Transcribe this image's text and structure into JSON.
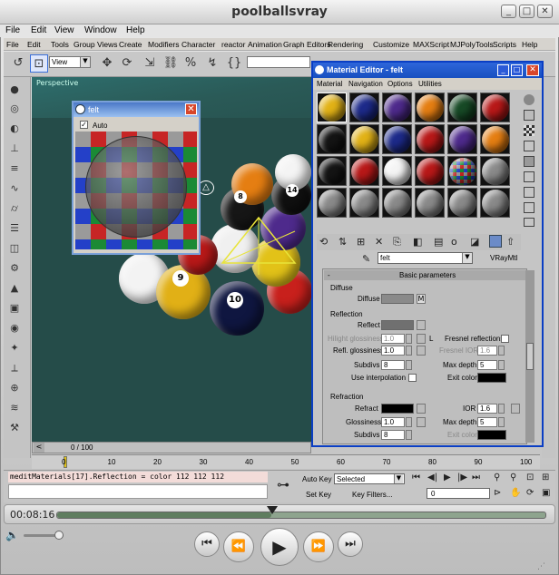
{
  "window": {
    "title": "poolballsvray",
    "minimize": "_",
    "maximize": "□",
    "close": "✕"
  },
  "menu": [
    "File",
    "Edit",
    "View",
    "Window",
    "Help"
  ],
  "max_menu": [
    "File",
    "Edit",
    "Tools",
    "Group",
    "Views",
    "Create",
    "Modifiers",
    "Character",
    "reactor",
    "Animation",
    "Graph Editors",
    "Rendering",
    "Customize",
    "MAXScript",
    "MJPolyTools",
    "Scripts",
    "Help"
  ],
  "toolbar": {
    "view_select": "View"
  },
  "viewport": {
    "label": "Perspective"
  },
  "felt_window": {
    "title": "felt",
    "auto_label": "Auto"
  },
  "material_editor": {
    "title": "Material Editor - felt",
    "menu": [
      "Material",
      "Navigation",
      "Options",
      "Utilities"
    ],
    "material_name": "felt",
    "material_type": "VRayMtl",
    "rollout_title": "Basic parameters",
    "diffuse_group": "Diffuse",
    "diffuse_label": "Diffuse",
    "diffuse_map_btn": "M",
    "reflection_group": "Reflection",
    "reflect_label": "Reflect",
    "hilight_gloss_label": "Hilight glossiness",
    "hilight_gloss_value": "1.0",
    "l_btn": "L",
    "fresnel_label": "Fresnel reflections",
    "refl_gloss_label": "Refl. glossiness",
    "refl_gloss_value": "1.0",
    "fresnel_ior_label": "Fresnel IOR",
    "fresnel_ior_value": "1.6",
    "subdivs_label": "Subdivs",
    "subdivs_value": "8",
    "max_depth_label": "Max depth",
    "max_depth_value": "5",
    "use_interp_label": "Use interpolation",
    "exit_color_label": "Exit color",
    "refraction_group": "Refraction",
    "refract_label": "Refract",
    "ior_label": "IOR",
    "ior_value": "1.6",
    "glossiness_label": "Glossiness",
    "glossiness_value": "1.0",
    "r_max_depth_label": "Max depth",
    "r_max_depth_value": "5",
    "r_subdivs_label": "Subdivs",
    "r_subdivs_value": "8",
    "r_exit_color_label": "Exit color"
  },
  "timeline": {
    "frame": "0 / 100",
    "ticks": [
      "0",
      "10",
      "20",
      "30",
      "40",
      "50",
      "60",
      "70",
      "80",
      "90",
      "100"
    ]
  },
  "status": {
    "maxscript": "meditMaterials[17].Reflection = color 112 112 112",
    "auto_key": "Auto Key",
    "selected": "Selected",
    "set_key": "Set Key",
    "key_filters": "Key Filters...",
    "frame_field": "0"
  },
  "player": {
    "time": "00:08:16",
    "progress": 0.44
  }
}
